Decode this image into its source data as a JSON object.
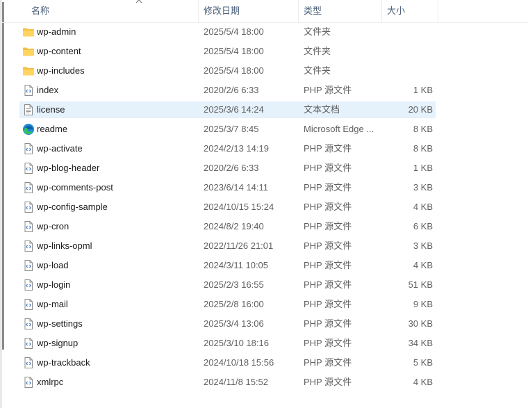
{
  "columns": {
    "name": "名称",
    "date": "修改日期",
    "type": "类型",
    "size": "大小"
  },
  "colors": {
    "folder": "#f5c044",
    "selection": "#e5f1fb",
    "header_text": "#4c607a"
  },
  "files": [
    {
      "name": "wp-admin",
      "date": "2025/5/4 18:00",
      "type": "文件夹",
      "size": "",
      "icon": "folder-icon"
    },
    {
      "name": "wp-content",
      "date": "2025/5/4 18:00",
      "type": "文件夹",
      "size": "",
      "icon": "folder-icon"
    },
    {
      "name": "wp-includes",
      "date": "2025/5/4 18:00",
      "type": "文件夹",
      "size": "",
      "icon": "folder-icon"
    },
    {
      "name": "index",
      "date": "2020/2/6 6:33",
      "type": "PHP 源文件",
      "size": "1 KB",
      "icon": "php-file-icon"
    },
    {
      "name": "license",
      "date": "2025/3/6 14:24",
      "type": "文本文档",
      "size": "20 KB",
      "icon": "text-file-icon",
      "selected": true
    },
    {
      "name": "readme",
      "date": "2025/3/7 8:45",
      "type": "Microsoft Edge ...",
      "size": "8 KB",
      "icon": "edge-icon"
    },
    {
      "name": "wp-activate",
      "date": "2024/2/13 14:19",
      "type": "PHP 源文件",
      "size": "8 KB",
      "icon": "php-file-icon"
    },
    {
      "name": "wp-blog-header",
      "date": "2020/2/6 6:33",
      "type": "PHP 源文件",
      "size": "1 KB",
      "icon": "php-file-icon"
    },
    {
      "name": "wp-comments-post",
      "date": "2023/6/14 14:11",
      "type": "PHP 源文件",
      "size": "3 KB",
      "icon": "php-file-icon"
    },
    {
      "name": "wp-config-sample",
      "date": "2024/10/15 15:24",
      "type": "PHP 源文件",
      "size": "4 KB",
      "icon": "php-file-icon"
    },
    {
      "name": "wp-cron",
      "date": "2024/8/2 19:40",
      "type": "PHP 源文件",
      "size": "6 KB",
      "icon": "php-file-icon"
    },
    {
      "name": "wp-links-opml",
      "date": "2022/11/26 21:01",
      "type": "PHP 源文件",
      "size": "3 KB",
      "icon": "php-file-icon"
    },
    {
      "name": "wp-load",
      "date": "2024/3/11 10:05",
      "type": "PHP 源文件",
      "size": "4 KB",
      "icon": "php-file-icon"
    },
    {
      "name": "wp-login",
      "date": "2025/2/3 16:55",
      "type": "PHP 源文件",
      "size": "51 KB",
      "icon": "php-file-icon"
    },
    {
      "name": "wp-mail",
      "date": "2025/2/8 16:00",
      "type": "PHP 源文件",
      "size": "9 KB",
      "icon": "php-file-icon"
    },
    {
      "name": "wp-settings",
      "date": "2025/3/4 13:06",
      "type": "PHP 源文件",
      "size": "30 KB",
      "icon": "php-file-icon"
    },
    {
      "name": "wp-signup",
      "date": "2025/3/10 18:16",
      "type": "PHP 源文件",
      "size": "34 KB",
      "icon": "php-file-icon"
    },
    {
      "name": "wp-trackback",
      "date": "2024/10/18 15:56",
      "type": "PHP 源文件",
      "size": "5 KB",
      "icon": "php-file-icon"
    },
    {
      "name": "xmlrpc",
      "date": "2024/11/8 15:52",
      "type": "PHP 源文件",
      "size": "4 KB",
      "icon": "php-file-icon"
    }
  ]
}
